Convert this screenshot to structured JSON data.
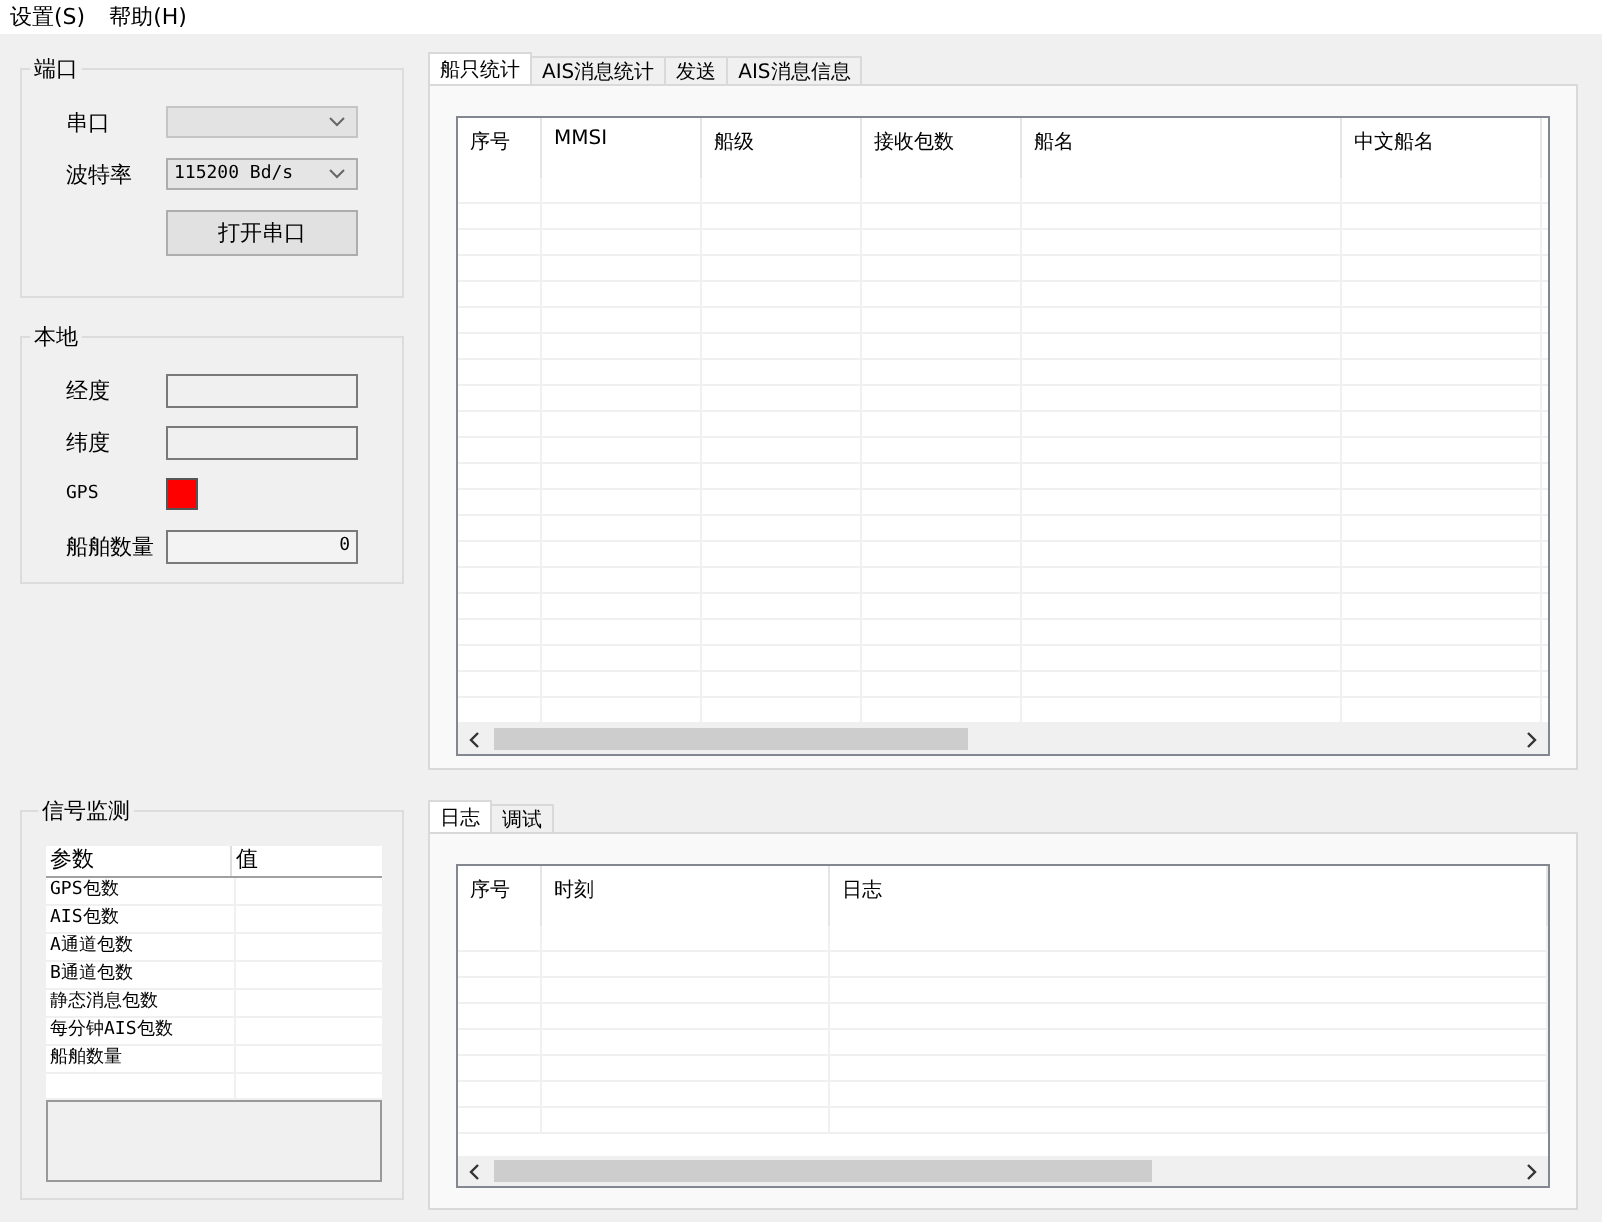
{
  "menu": [
    {
      "label": "设置(S)"
    },
    {
      "label": "帮助(H)"
    }
  ],
  "port": {
    "title": "端口",
    "serial_label": "串口",
    "baud_label": "波特率",
    "baud_value": "115200 Bd/s",
    "open_button": "打开串口"
  },
  "local": {
    "title": "本地",
    "lon_label": "经度",
    "lat_label": "纬度",
    "gps_label": "GPS",
    "gps_fix": false,
    "ships_label": "船舶数量",
    "ships_value": "0"
  },
  "signal": {
    "title": "信号监测",
    "columns": [
      "参数",
      "值"
    ],
    "rows": [
      "GPS包数",
      "AIS包数",
      "A通道包数",
      "B通道包数",
      "静态消息包数",
      "每分钟AIS包数",
      "船舶数量"
    ]
  },
  "top_tabs": [
    {
      "label": "船只统计",
      "selected": true
    },
    {
      "label": "AIS消息统计",
      "selected": false
    },
    {
      "label": "发送",
      "selected": false
    },
    {
      "label": "AIS消息信息",
      "selected": false
    }
  ],
  "ship_table": {
    "columns": [
      "序号",
      "MMSI",
      "船级",
      "接收包数",
      "船名",
      "中文船名"
    ]
  },
  "bottom_tabs": [
    {
      "label": "日志",
      "selected": true
    },
    {
      "label": "调试",
      "selected": false
    }
  ],
  "log_table": {
    "columns": [
      "序号",
      "时刻",
      "日志"
    ]
  }
}
